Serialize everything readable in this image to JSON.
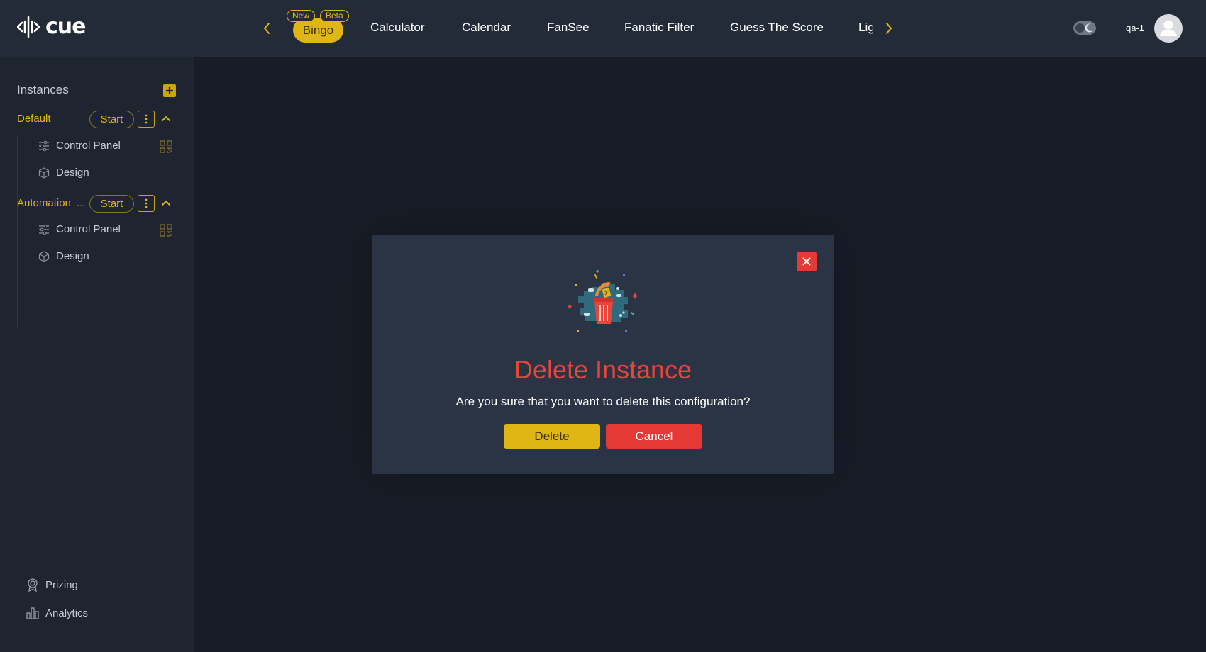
{
  "header": {
    "logo_text": "cue",
    "nav_items": [
      "Bingo",
      "Calculator",
      "Calendar",
      "FanSee",
      "Fanatic Filter",
      "Guess The Score",
      "Lig"
    ],
    "badges": {
      "new": "New",
      "beta": "Beta"
    },
    "username": "qa-1"
  },
  "sidebar": {
    "title": "Instances",
    "instances": [
      {
        "name": "Default",
        "start_label": "Start",
        "items": [
          "Control Panel",
          "Design"
        ]
      },
      {
        "name": "Automation_...",
        "start_label": "Start",
        "items": [
          "Control Panel",
          "Design"
        ]
      }
    ],
    "bottom": [
      "Prizing",
      "Analytics"
    ]
  },
  "modal": {
    "title": "Delete Instance",
    "message": "Are you sure that you want to delete this configuration?",
    "delete_label": "Delete",
    "cancel_label": "Cancel"
  },
  "colors": {
    "accent": "#e0b516",
    "danger": "#e53935",
    "topbar": "#232b38",
    "sidebar": "#1e2430",
    "background": "#171c26",
    "modal": "#2a3444"
  }
}
